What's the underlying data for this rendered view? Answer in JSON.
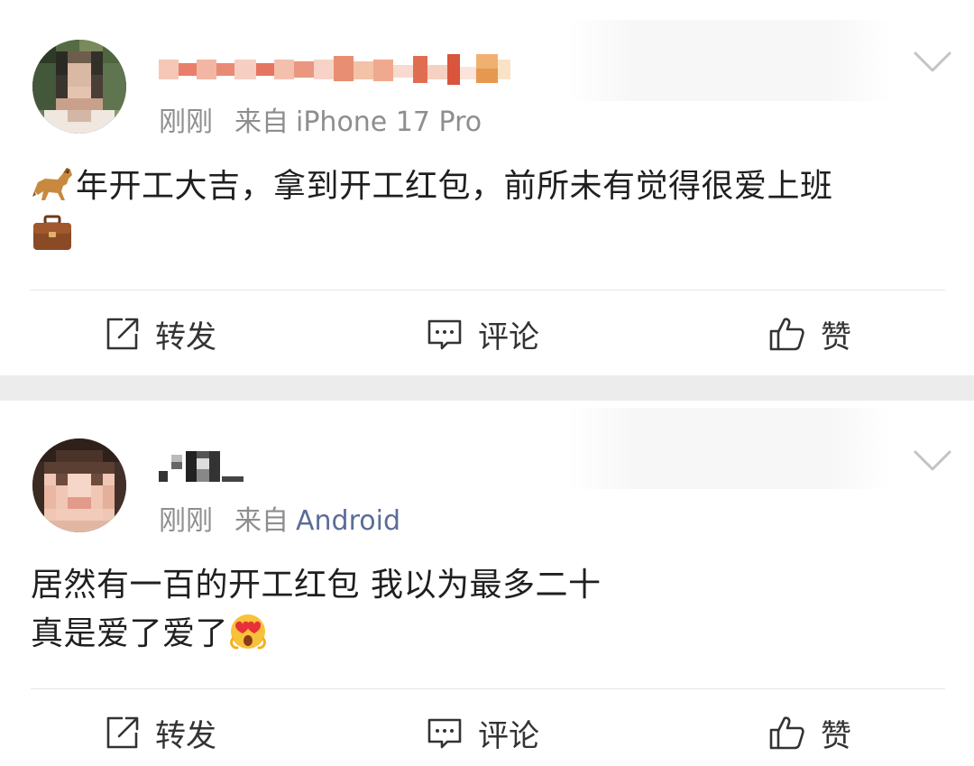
{
  "posts": [
    {
      "time": "刚刚",
      "source_prefix": "来自",
      "source": "iPhone 17 Pro",
      "text_emoji_start": "horse-emoji",
      "text": "年开工大吉，拿到开工红包，前所未有觉得很爱上班",
      "text_emoji_end": "briefcase-emoji",
      "actions": {
        "repost": "转发",
        "comment": "评论",
        "like": "赞"
      }
    },
    {
      "time": "刚刚",
      "source_prefix": "来自",
      "source": "Android",
      "text_line1": "居然有一百的开工红包 我以为最多二十",
      "text_line2": "真是爱了爱了",
      "text_emoji_end": "heart-eyes-emoji",
      "actions": {
        "repost": "转发",
        "comment": "评论",
        "like": "赞"
      }
    }
  ],
  "colors": {
    "meta_gray": "#8e8e8e",
    "source_link": "#5b6d96",
    "separator": "#ececec",
    "text": "#1f1f1f"
  }
}
